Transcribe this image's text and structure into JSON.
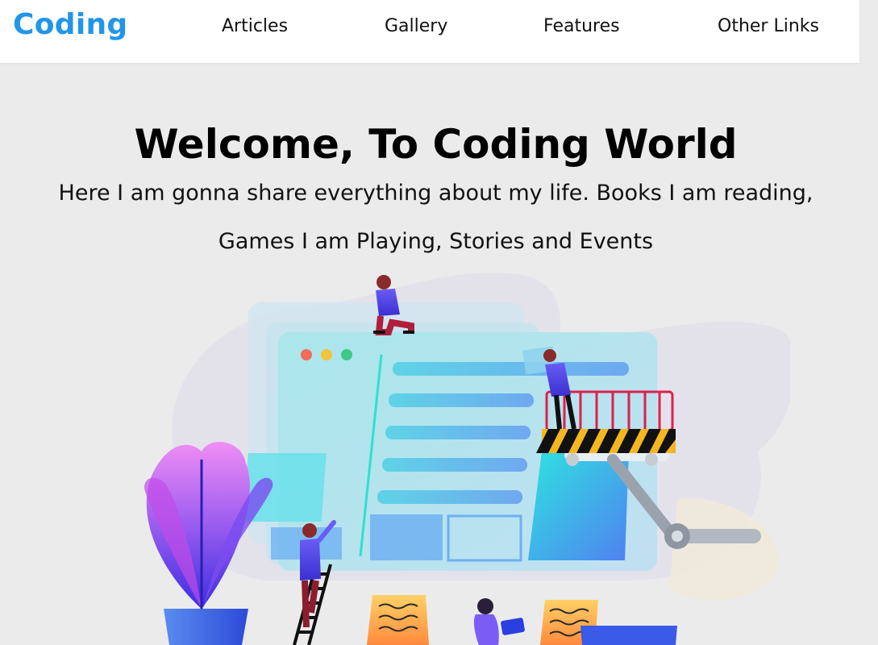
{
  "navbar": {
    "brand": "Coding",
    "links": [
      "Articles",
      "Gallery",
      "Features",
      "Other Links"
    ]
  },
  "hero": {
    "title": "Welcome, To Coding World",
    "subtitle_line1": "Here I am gonna share everything about my life. Books I am reading,",
    "subtitle_line2": "Games I am Playing, Stories and Events"
  },
  "icons": [
    "coding-illustration"
  ],
  "colors": {
    "brand": "#2196e9",
    "page_bg": "#ebebeb",
    "navbar_bg": "#ffffff"
  }
}
